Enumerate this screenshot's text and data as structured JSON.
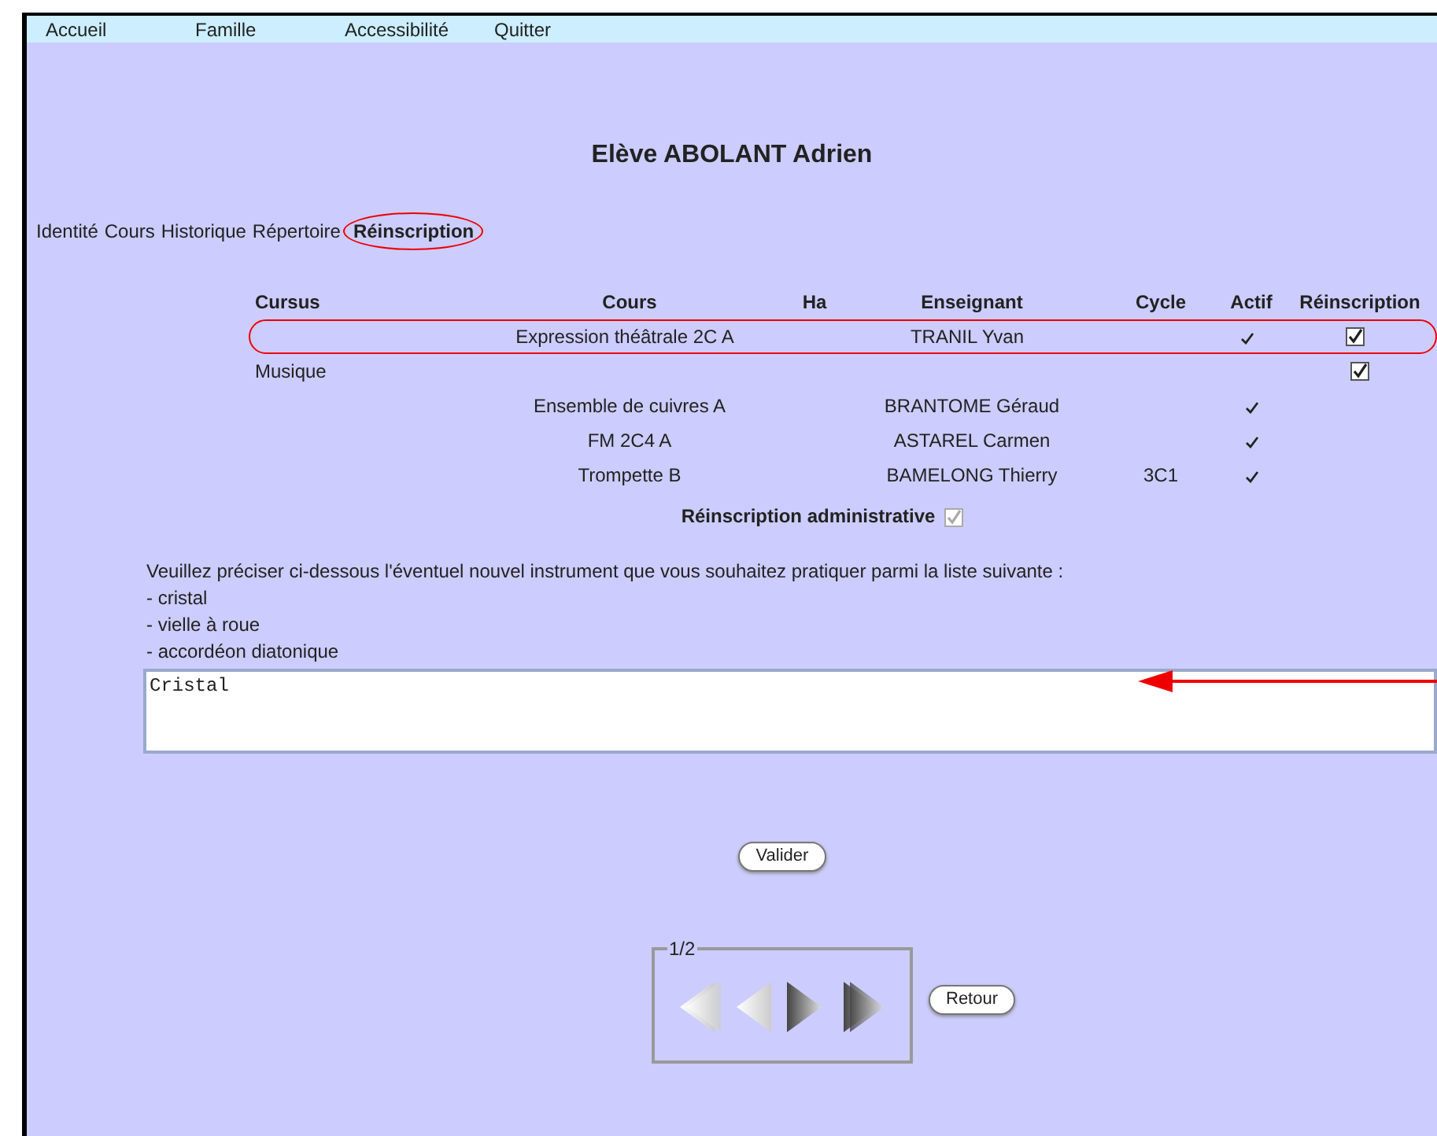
{
  "menu": [
    {
      "label": "Accueil"
    },
    {
      "label": "Famille"
    },
    {
      "label": "Accessibilité"
    },
    {
      "label": "Quitter"
    }
  ],
  "title": "Elève ABOLANT Adrien",
  "tabs": [
    {
      "label": "Identité",
      "selected": false,
      "circled": false
    },
    {
      "label": "Cours",
      "selected": false,
      "circled": false
    },
    {
      "label": "Historique",
      "selected": false,
      "circled": false
    },
    {
      "label": "Répertoire",
      "selected": false,
      "circled": false
    },
    {
      "label": "Réinscription",
      "selected": true,
      "circled": true
    }
  ],
  "table": {
    "columns": [
      "Cursus",
      "Cours",
      "Ha",
      "Enseignant",
      "Cycle",
      "Actif",
      "Réinscription"
    ],
    "rows": [
      {
        "cursus": "",
        "cours": "Expression théâtrale 2C A",
        "enseignant": "TRANIL Yvan",
        "cycle": "",
        "actif": true,
        "reinscription": true,
        "circled": true
      },
      {
        "cursus": "Musique",
        "cours": "",
        "enseignant": "",
        "cycle": "",
        "actif": false,
        "reinscription": true,
        "circled": false
      },
      {
        "cursus": "",
        "cours": "Ensemble de cuivres A",
        "enseignant": "BRANTOME Géraud",
        "cycle": "",
        "actif": true,
        "circled": false
      },
      {
        "cursus": "",
        "cours": "FM 2C4 A",
        "enseignant": "ASTAREL Carmen",
        "cycle": "",
        "actif": true,
        "circled": false
      },
      {
        "cursus": "",
        "cours": "Trompette B",
        "enseignant": "BAMELONG Thierry",
        "cycle": "3C1",
        "actif": true,
        "circled": false
      }
    ]
  },
  "admin": {
    "label": "Réinscription administrative",
    "checked": true,
    "disabled": true
  },
  "instructions": [
    "Veuillez préciser ci-dessous l'éventuel nouvel instrument que vous souhaitez pratiquer parmi la liste suivante :",
    "- cristal",
    "- vielle à roue",
    "- accordéon diatonique"
  ],
  "answer": {
    "value": "Cristal",
    "arrow": true
  },
  "submit": "Valider",
  "pager": {
    "legend": "1/2",
    "buttons": [
      {
        "kind": "first",
        "disabled": true
      },
      {
        "kind": "prev",
        "disabled": true
      },
      {
        "kind": "next",
        "disabled": false
      },
      {
        "kind": "last",
        "disabled": false
      }
    ]
  },
  "back": "Retour"
}
